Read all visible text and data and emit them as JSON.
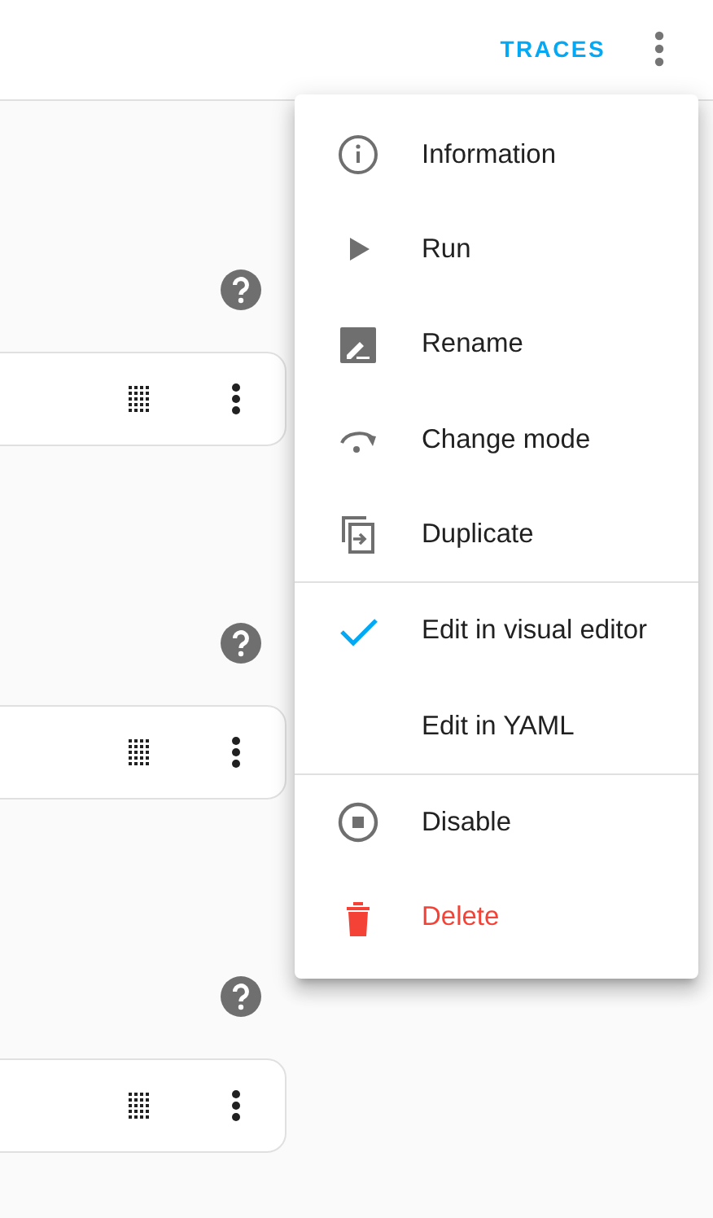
{
  "header": {
    "action": "TRACES"
  },
  "menu": {
    "groups": [
      [
        {
          "label": "Information",
          "kind": "normal"
        },
        {
          "label": "Run",
          "kind": "normal"
        },
        {
          "label": "Rename",
          "kind": "normal"
        },
        {
          "label": "Change mode",
          "kind": "normal"
        },
        {
          "label": "Duplicate",
          "kind": "normal"
        }
      ],
      [
        {
          "label": "Edit in visual editor",
          "kind": "option",
          "checked": true
        },
        {
          "label": "Edit in YAML",
          "kind": "option",
          "checked": false
        }
      ],
      [
        {
          "label": "Disable",
          "kind": "normal"
        },
        {
          "label": "Delete",
          "kind": "danger"
        }
      ]
    ]
  }
}
